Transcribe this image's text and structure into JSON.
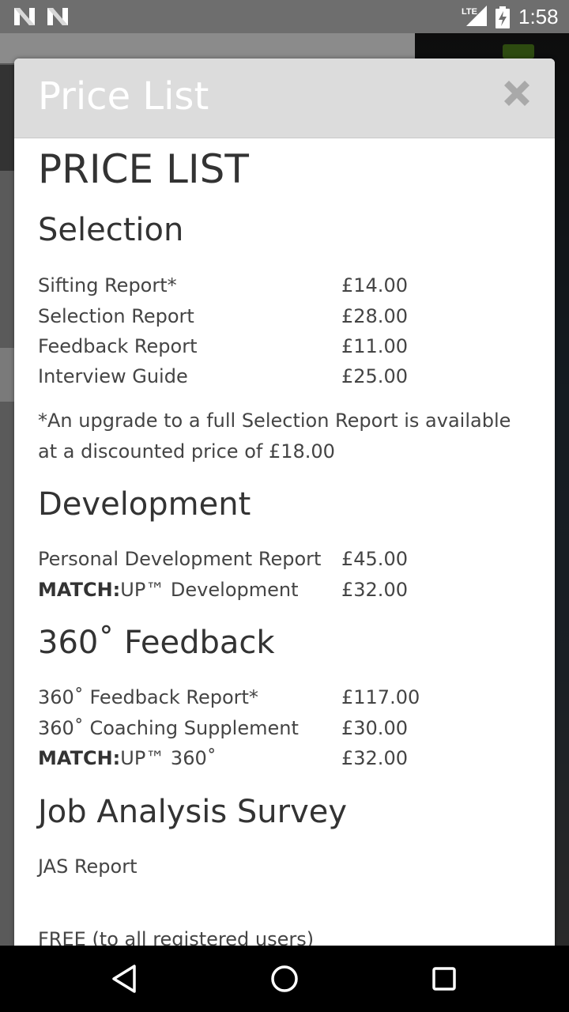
{
  "status_bar": {
    "network": "LTE",
    "time": "1:58"
  },
  "modal": {
    "title": "Price List",
    "close_icon": "close-icon",
    "heading": "PRICE LIST",
    "sections": [
      {
        "title": "Selection",
        "items": [
          {
            "name": "Sifting Report*",
            "price": "£14.00"
          },
          {
            "name": "Selection Report",
            "price": "£28.00"
          },
          {
            "name": "Feedback Report",
            "price": "£11.00"
          },
          {
            "name": "Interview Guide",
            "price": "£25.00"
          }
        ],
        "note": "*An upgrade to a full Selection Report is available at a discounted price of £18.00"
      },
      {
        "title": "Development",
        "items": [
          {
            "name": "Personal Development Report",
            "price": "£45.00"
          },
          {
            "name_bold": "MATCH:",
            "name_rest": "UP™ Development",
            "price": "£32.00"
          }
        ]
      },
      {
        "title": "360˚ Feedback",
        "items": [
          {
            "name": "360˚ Feedback Report*",
            "price": "£117.00"
          },
          {
            "name": "360˚ Coaching Supplement",
            "price": "£30.00"
          },
          {
            "name_bold": "MATCH:",
            "name_rest": "UP™ 360˚",
            "price": "£32.00"
          }
        ]
      },
      {
        "title": "Job Analysis Survey",
        "items": [
          {
            "name": "JAS Report"
          }
        ],
        "free_text": "FREE (to all registered users)"
      }
    ]
  },
  "nav_bar": {
    "back_icon": "back-icon",
    "home_icon": "home-icon",
    "recents_icon": "recents-icon"
  }
}
